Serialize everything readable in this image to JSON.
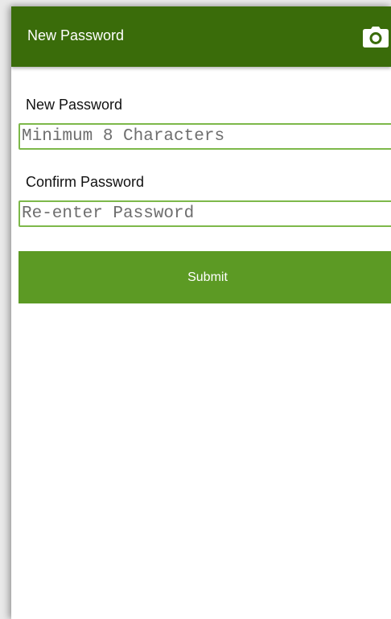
{
  "app_bar": {
    "title": "New Password",
    "camera_icon": "camera-icon",
    "color": "#3a6c0a"
  },
  "form": {
    "new_password": {
      "label": "New Password",
      "value": "",
      "placeholder": "Minimum 8 Characters"
    },
    "confirm_password": {
      "label": "Confirm Password",
      "value": "",
      "placeholder": "Re-enter Password"
    },
    "submit": {
      "label": "Submit",
      "color": "#5c9a24"
    },
    "input_border_color": "#7db84a"
  }
}
